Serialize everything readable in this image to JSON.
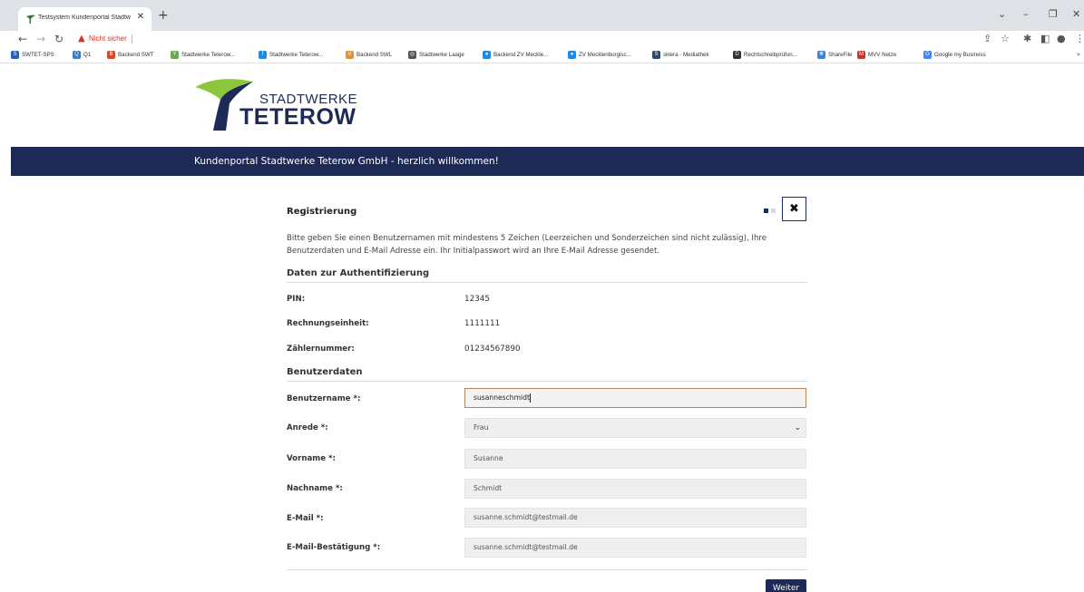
{
  "browser": {
    "tab_title": "Testsystem Kundenportal Stadtw",
    "new_tab": "+",
    "address_warning": "Nicht sicher",
    "window_controls": {
      "minimize": "–",
      "restore": "❐",
      "close": "✕",
      "dropdown": "⌄"
    },
    "bookmarks": [
      {
        "label": "SWTET-SPS",
        "icon": "sharepoint-icon",
        "color": "#2b5fb4",
        "glyph": "S"
      },
      {
        "label": "Q1",
        "icon": "q1-icon",
        "color": "#3b7bbf",
        "glyph": "Q"
      },
      {
        "label": "Backend SWT",
        "icon": "backend-icon",
        "color": "#d9472b",
        "glyph": "B"
      },
      {
        "label": "Stadtwerke Teterow...",
        "icon": "stadtwerke-icon",
        "color": "#6aa84f",
        "glyph": "Y"
      },
      {
        "label": "Stadtwerke Teterow...",
        "icon": "stadtwerke-blue-icon",
        "color": "#1e88e5",
        "glyph": "f"
      },
      {
        "label": "Backend SWL",
        "icon": "swl-icon",
        "color": "#e69138",
        "glyph": "V"
      },
      {
        "label": "Stadtwerke Laage",
        "icon": "laage-icon",
        "color": "#555555",
        "glyph": "◎"
      },
      {
        "label": "Backend ZV Meckle...",
        "icon": "zv-icon",
        "color": "#1e88e5",
        "glyph": "●"
      },
      {
        "label": "ZV Mecklenburgisc...",
        "icon": "zv-mecklenburg-icon",
        "color": "#1e88e5",
        "glyph": "●"
      },
      {
        "label": "sklera - Mediathek",
        "icon": "sklera-icon",
        "color": "#2e4a6b",
        "glyph": "S"
      },
      {
        "label": "Rechtschreibprüfun...",
        "icon": "spellcheck-icon",
        "color": "#333333",
        "glyph": "D"
      },
      {
        "label": "ShareFile",
        "icon": "sharefile-icon",
        "color": "#3f7fd6",
        "glyph": "❋"
      },
      {
        "label": "MVV Netze",
        "icon": "mvv-icon",
        "color": "#c0392b",
        "glyph": "M"
      },
      {
        "label": "Google my Business",
        "icon": "google-icon",
        "color": "#4285f4",
        "glyph": "G"
      }
    ]
  },
  "brand": {
    "logo_top": "STADTWERKE",
    "logo_bottom": "TETEROW",
    "navy": "#1c2a55",
    "green": "#8cc63f"
  },
  "banner": {
    "text": "Kundenportal Stadtwerke Teterow GmbH - herzlich willkommen!"
  },
  "registration": {
    "title": "Registrierung",
    "close_icon": "✖",
    "intro": "Bitte geben Sie einen Benutzernamen mit mindestens 5 Zeichen (Leerzeichen und Sonderzeichen sind nicht zulässig), Ihre Benutzerdaten und E-Mail Adresse ein. Ihr Initialpasswort wird an Ihre E-Mail Adresse gesendet.",
    "auth_section": "Daten zur Authentifizierung",
    "auth_rows": [
      {
        "label": "PIN:",
        "value": "12345"
      },
      {
        "label": "Rechnungseinheit:",
        "value": "1111111"
      },
      {
        "label": "Zählernummer:",
        "value": "01234567890"
      }
    ],
    "user_section": "Benutzerdaten",
    "fields": {
      "username": {
        "label": "Benutzername *:",
        "value": "susanneschmidt"
      },
      "salutation": {
        "label": "Anrede *:",
        "value": "Frau",
        "chevron": "⌄"
      },
      "firstname": {
        "label": "Vorname *:",
        "value": "Susanne"
      },
      "lastname": {
        "label": "Nachname *:",
        "value": "Schmidt"
      },
      "email": {
        "label": "E-Mail *:",
        "value": "susanne.schmidt@testmail.de"
      },
      "email_confirm": {
        "label": "E-Mail-Bestätigung *:",
        "value": "susanne.schmidt@testmail.de"
      }
    },
    "next_button": "Weiter"
  }
}
